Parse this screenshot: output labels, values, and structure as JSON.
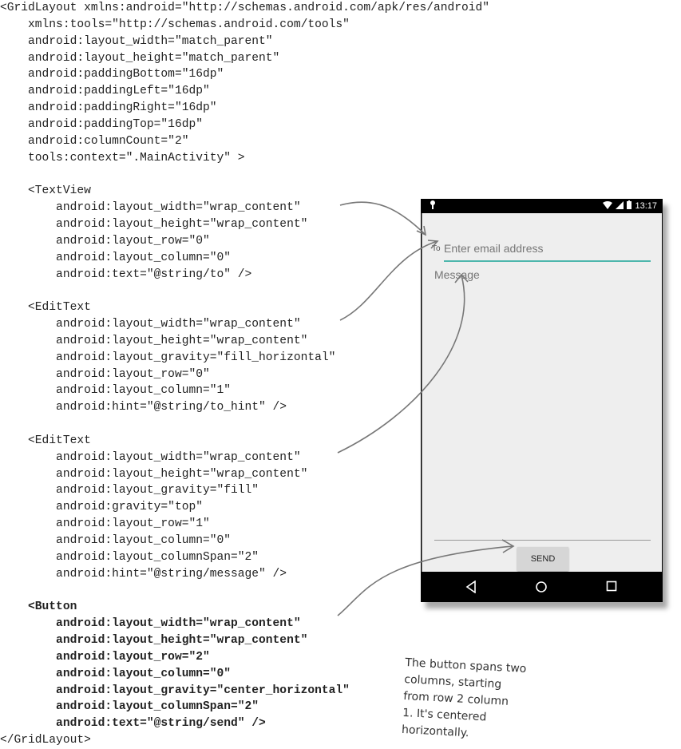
{
  "code_lines": [
    "<GridLayout xmlns:android=\"http://schemas.android.com/apk/res/android\"",
    "    xmlns:tools=\"http://schemas.android.com/tools\"",
    "    android:layout_width=\"match_parent\"",
    "    android:layout_height=\"match_parent\"",
    "    android:paddingBottom=\"16dp\"",
    "    android:paddingLeft=\"16dp\"",
    "    android:paddingRight=\"16dp\"",
    "    android:paddingTop=\"16dp\"",
    "    android:columnCount=\"2\"",
    "    tools:context=\".MainActivity\" >",
    "",
    "    <TextView",
    "        android:layout_width=\"wrap_content\"",
    "        android:layout_height=\"wrap_content\"",
    "        android:layout_row=\"0\"",
    "        android:layout_column=\"0\"",
    "        android:text=\"@string/to\" />",
    "",
    "    <EditText",
    "        android:layout_width=\"wrap_content\"",
    "        android:layout_height=\"wrap_content\"",
    "        android:layout_gravity=\"fill_horizontal\"",
    "        android:layout_row=\"0\"",
    "        android:layout_column=\"1\"",
    "        android:hint=\"@string/to_hint\" />",
    "",
    "    <EditText",
    "        android:layout_width=\"wrap_content\"",
    "        android:layout_height=\"wrap_content\"",
    "        android:layout_gravity=\"fill\"",
    "        android:gravity=\"top\"",
    "        android:layout_row=\"1\"",
    "        android:layout_column=\"0\"",
    "        android:layout_columnSpan=\"2\"",
    "        android:hint=\"@string/message\" />",
    "",
    "    <Button",
    "        android:layout_width=\"wrap_content\"",
    "        android:layout_height=\"wrap_content\"",
    "        android:layout_row=\"2\"",
    "        android:layout_column=\"0\"",
    "        android:layout_gravity=\"center_horizontal\"",
    "        android:layout_columnSpan=\"2\"",
    "        android:text=\"@string/send\" />",
    "</GridLayout>"
  ],
  "phone": {
    "status_time": "13:17",
    "to_label": "To",
    "email_hint": "Enter email address",
    "message_hint": "Message",
    "send_label": "SEND"
  },
  "note_lines": [
    "The button spans two",
    "columns, starting",
    "from row 2 column",
    "1. It's centered",
    "horizontally."
  ]
}
